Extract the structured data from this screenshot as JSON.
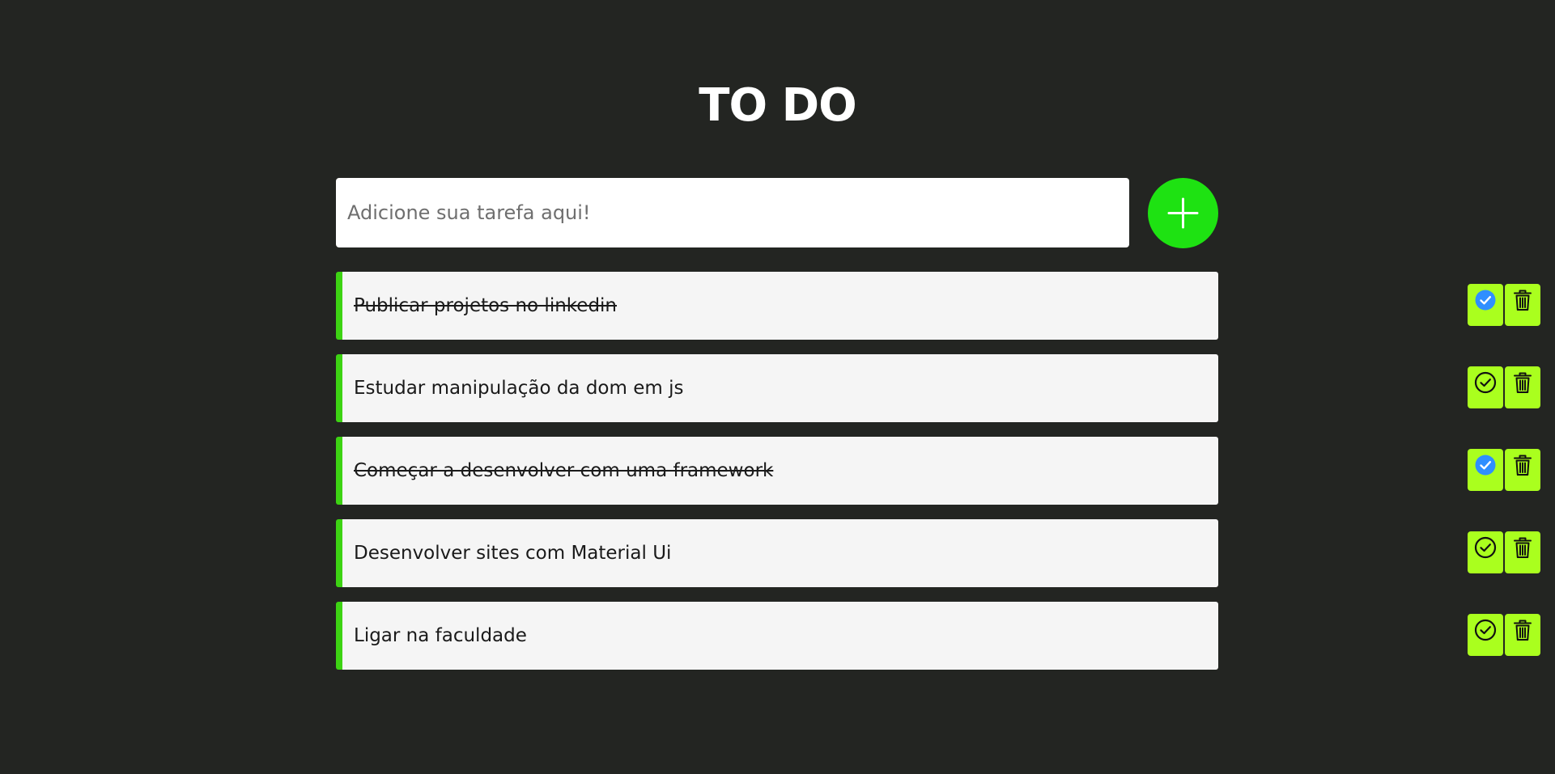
{
  "app": {
    "title": "TO DO"
  },
  "input": {
    "placeholder": "Adicione sua tarefa aqui!",
    "value": ""
  },
  "add_button": {
    "icon": "plus-icon",
    "color": "#1ee212"
  },
  "colors": {
    "background": "#232522",
    "task_accent": "#3dd313",
    "action_button": "#aaff1e",
    "checked": "#2f8fff"
  },
  "tasks": [
    {
      "label": "Publicar projetos no linkedin",
      "done": true
    },
    {
      "label": "Estudar manipulação da dom em js",
      "done": false
    },
    {
      "label": "Começar a desenvolver com uma framework",
      "done": true
    },
    {
      "label": "Desenvolver sites com Material Ui",
      "done": false
    },
    {
      "label": "Ligar na faculdade",
      "done": false
    }
  ],
  "icons": {
    "check_done": "check-circle-filled-icon",
    "check_pending": "check-circle-outline-icon",
    "delete": "trash-icon"
  }
}
